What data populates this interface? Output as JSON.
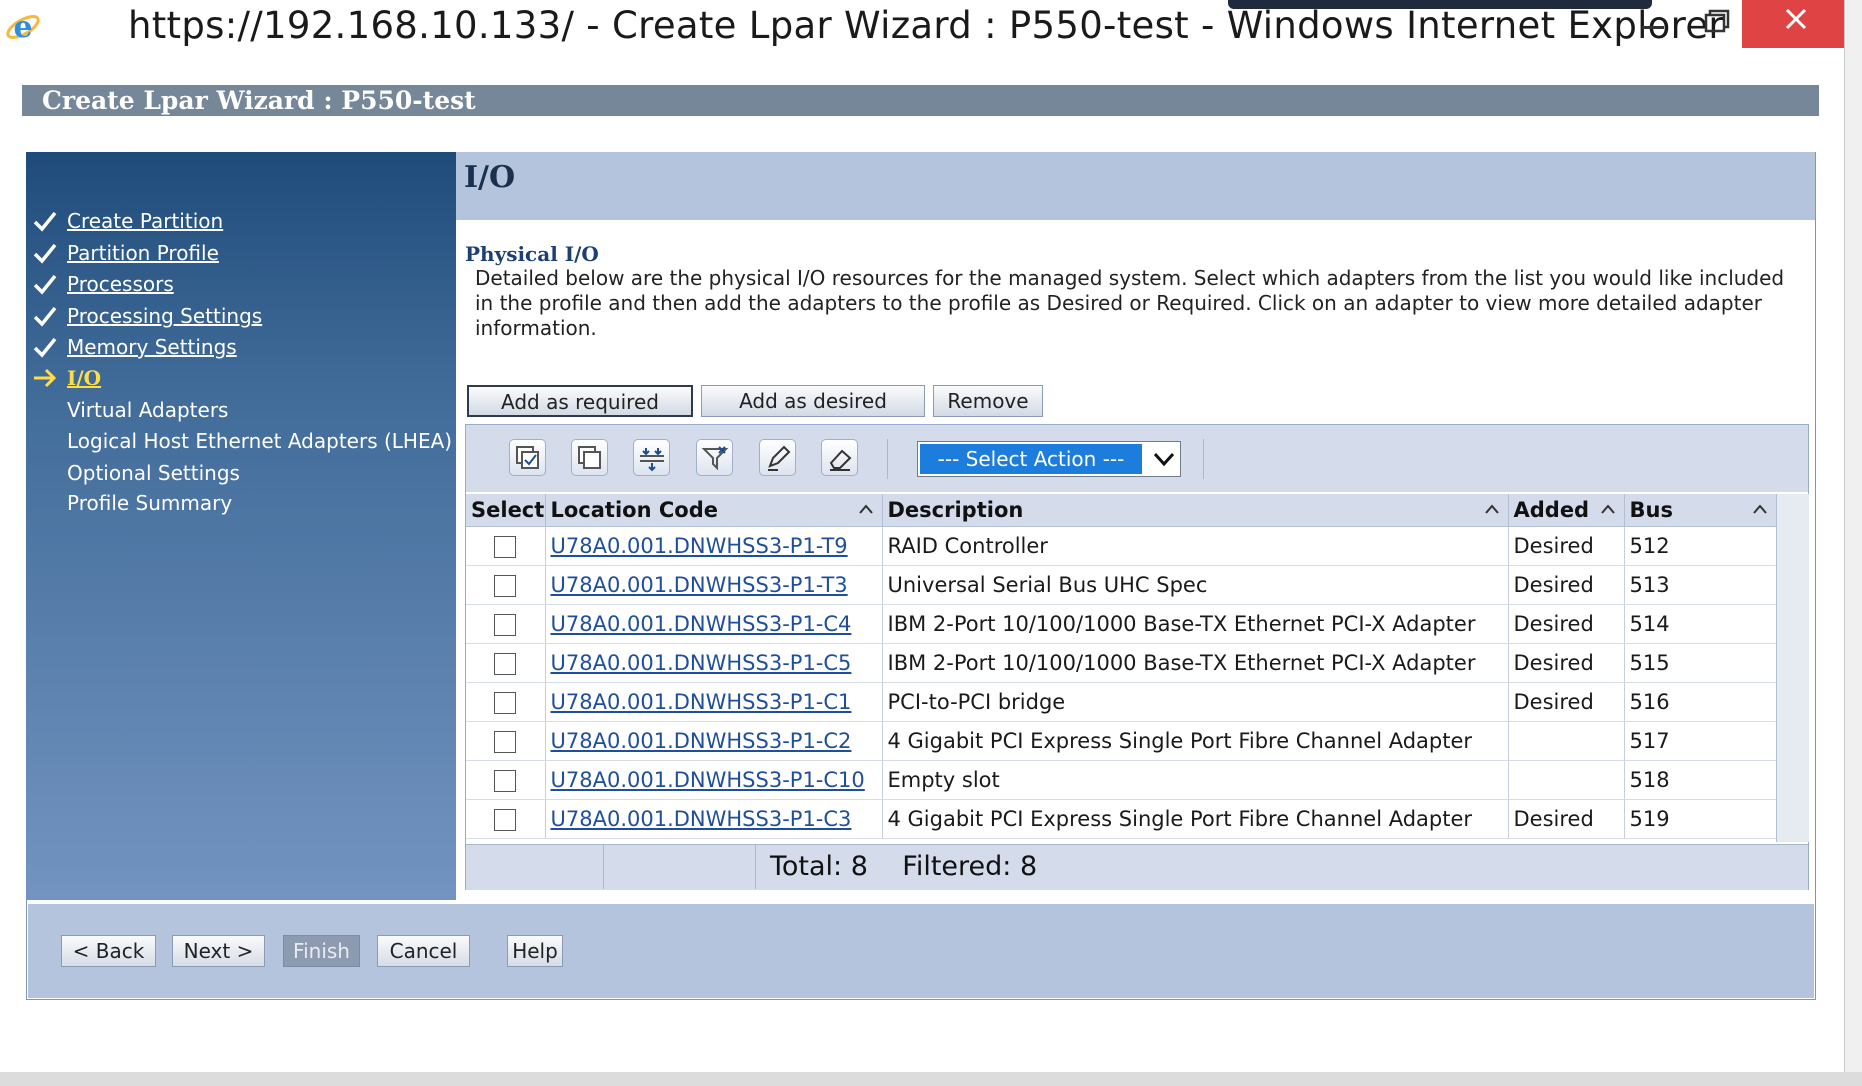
{
  "window": {
    "title": "https://192.168.10.133/ - Create Lpar Wizard : P550-test - Windows Internet Explorer"
  },
  "page": {
    "header": "Create Lpar Wizard : P550-test"
  },
  "steps": [
    {
      "label": "Create Partition",
      "state": "done"
    },
    {
      "label": "Partition Profile",
      "state": "done"
    },
    {
      "label": "Processors",
      "state": "done"
    },
    {
      "label": "Processing Settings",
      "state": "done"
    },
    {
      "label": "Memory Settings",
      "state": "done"
    },
    {
      "label": "I/O",
      "state": "current"
    },
    {
      "label": "Virtual Adapters",
      "state": "pending"
    },
    {
      "label": "Logical Host Ethernet Adapters (LHEA)",
      "state": "pending"
    },
    {
      "label": "Optional Settings",
      "state": "pending"
    },
    {
      "label": "Profile Summary",
      "state": "pending"
    }
  ],
  "section": {
    "title": "I/O",
    "subtitle": "Physical I/O",
    "description": " Detailed below are the physical I/O resources for the managed system. Select which adapters from the list you would like included in the profile and then add the adapters to the profile as Desired or Required. Click on an adapter to view more detailed adapter information."
  },
  "actions": {
    "add_required": "Add as required",
    "add_desired": "Add as desired",
    "remove": "Remove"
  },
  "toolbar": {
    "icons": [
      "select-all-icon",
      "deselect-all-icon",
      "show-filter-row-icon",
      "clear-filters-icon",
      "edit-sort-icon",
      "clear-sorts-icon"
    ],
    "select_action": "--- Select Action ---"
  },
  "table": {
    "columns": [
      "Select",
      "Location Code",
      "Description",
      "Added",
      "Bus"
    ],
    "rows": [
      {
        "location": "U78A0.001.DNWHSS3-P1-T9",
        "description": "RAID Controller",
        "added": "Desired",
        "bus": "512"
      },
      {
        "location": "U78A0.001.DNWHSS3-P1-T3",
        "description": "Universal Serial Bus UHC Spec",
        "added": "Desired",
        "bus": "513"
      },
      {
        "location": "U78A0.001.DNWHSS3-P1-C4",
        "description": "IBM 2-Port 10/100/1000 Base-TX Ethernet PCI-X Adapter",
        "added": "Desired",
        "bus": "514"
      },
      {
        "location": "U78A0.001.DNWHSS3-P1-C5",
        "description": "IBM 2-Port 10/100/1000 Base-TX Ethernet PCI-X Adapter",
        "added": "Desired",
        "bus": "515"
      },
      {
        "location": "U78A0.001.DNWHSS3-P1-C1",
        "description": "PCI-to-PCI bridge",
        "added": "Desired",
        "bus": "516"
      },
      {
        "location": "U78A0.001.DNWHSS3-P1-C2",
        "description": "4 Gigabit PCI Express Single Port Fibre Channel Adapter",
        "added": "",
        "bus": "517"
      },
      {
        "location": "U78A0.001.DNWHSS3-P1-C10",
        "description": "Empty slot",
        "added": "",
        "bus": "518"
      },
      {
        "location": "U78A0.001.DNWHSS3-P1-C3",
        "description": "4 Gigabit PCI Express Single Port Fibre Channel Adapter",
        "added": "Desired",
        "bus": "519"
      }
    ],
    "total": "Total: 8",
    "filtered": "Filtered: 8"
  },
  "nav": {
    "back": "< Back",
    "next": "Next >",
    "finish": "Finish",
    "cancel": "Cancel",
    "help": "Help"
  }
}
